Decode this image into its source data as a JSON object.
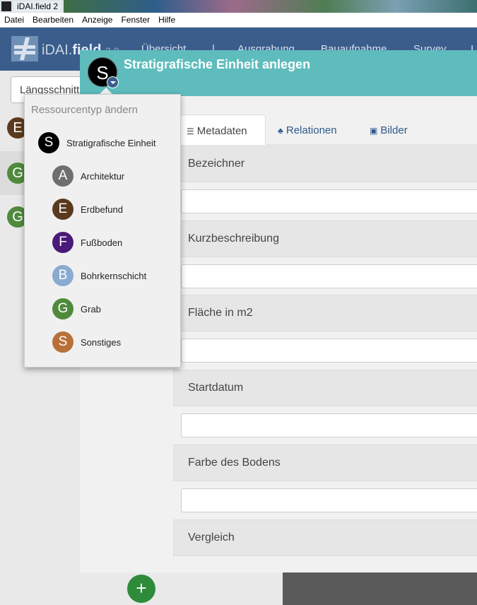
{
  "window": {
    "title": "iDAI.field 2"
  },
  "menu": [
    "Datei",
    "Bearbeiten",
    "Anzeige",
    "Fenster",
    "Hilfe"
  ],
  "navbar": {
    "brand": "iDAI.",
    "brand_bold": "field",
    "version": "2.0",
    "tabs": [
      "Übersicht",
      "|",
      "Ausgrabung",
      "Bauaufnahme",
      "Survey",
      "I"
    ]
  },
  "background": {
    "select_value": "Längsschnitt",
    "rows": [
      {
        "letter": "E",
        "color": "#5a3a1e"
      },
      {
        "letter": "G",
        "color": "#4f8a3c"
      },
      {
        "letter": "G",
        "color": "#4f8a3c"
      }
    ],
    "add_symbol": "+"
  },
  "modal": {
    "title": "Stratigrafische Einheit anlegen",
    "type_letter": "S",
    "tabs": [
      {
        "icon": "list-icon",
        "glyph": "☰",
        "label": "Metadaten"
      },
      {
        "icon": "sitemap-icon",
        "glyph": "♣",
        "label": "Relationen"
      },
      {
        "icon": "image-icon",
        "glyph": "▣",
        "label": "Bilder"
      }
    ],
    "fields": [
      {
        "label": "Bezeichner",
        "value": ""
      },
      {
        "label": "Kurzbeschreibung",
        "value": ""
      },
      {
        "label": "Fläche in m2",
        "value": ""
      },
      {
        "label": "Startdatum",
        "value": ""
      },
      {
        "label": "Farbe des Bodens",
        "value": ""
      },
      {
        "label": "Vergleich"
      }
    ]
  },
  "popover": {
    "title": "Ressourcentyp ändern",
    "items": [
      {
        "letter": "S",
        "label": "Stratigrafische Einheit",
        "color": "#000000"
      },
      {
        "letter": "A",
        "label": "Architektur",
        "color": "#6f6f6f"
      },
      {
        "letter": "E",
        "label": "Erdbefund",
        "color": "#5a3a1e"
      },
      {
        "letter": "F",
        "label": "Fußboden",
        "color": "#4a1a7a"
      },
      {
        "letter": "B",
        "label": "Bohrkernschicht",
        "color": "#8aaad0"
      },
      {
        "letter": "G",
        "label": "Grab",
        "color": "#4f8a3c"
      },
      {
        "letter": "S",
        "label": "Sonstiges",
        "color": "#b87038"
      }
    ]
  }
}
